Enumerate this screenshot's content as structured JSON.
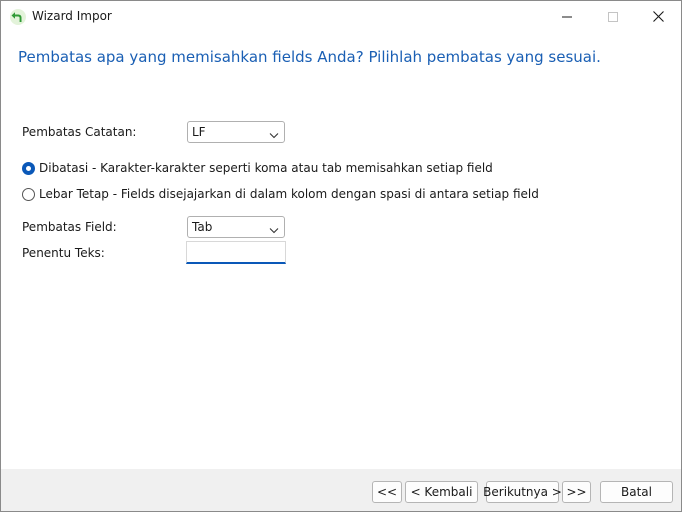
{
  "window": {
    "title": "Wizard Impor",
    "icon": "green-back-arrow-icon"
  },
  "heading": "Pembatas apa yang memisahkan fields Anda? Pilihlah pembatas yang sesuai.",
  "record_delimiter": {
    "label": "Pembatas Catatan:",
    "value": "LF"
  },
  "options": {
    "delimited": {
      "label": "Dibatasi - Karakter-karakter seperti koma atau tab memisahkan setiap field",
      "selected": true
    },
    "fixed_width": {
      "label": "Lebar Tetap - Fields disejajarkan di dalam kolom dengan spasi di antara setiap field",
      "selected": false
    }
  },
  "field_delimiter": {
    "label": "Pembatas Field:",
    "value": "Tab"
  },
  "text_qualifier": {
    "label": "Penentu Teks:",
    "value": ""
  },
  "buttons": {
    "first": "<<",
    "back": "< Kembali",
    "next": "Berikutnya >",
    "last": ">>",
    "cancel": "Batal"
  },
  "colors": {
    "heading": "#1a5fb4",
    "accent": "#0a58b8"
  }
}
